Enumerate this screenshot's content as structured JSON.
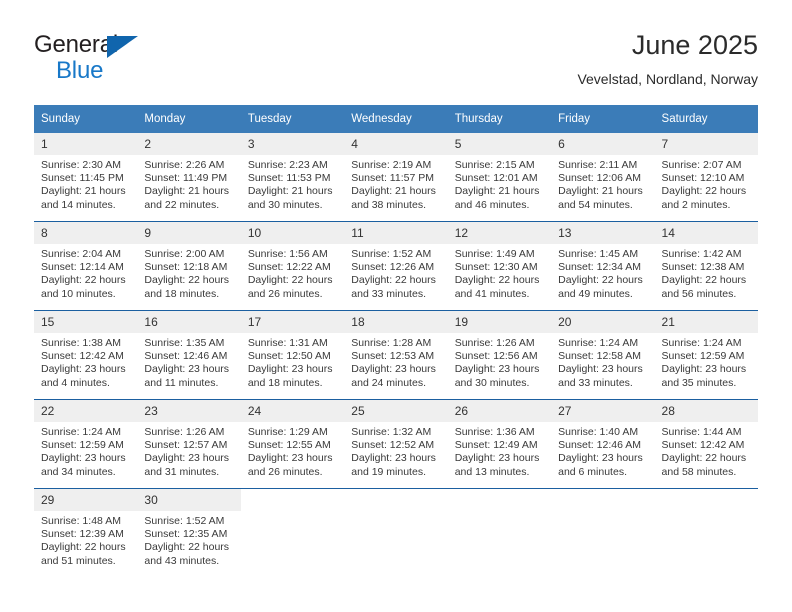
{
  "brand": {
    "line1": "General",
    "line2": "Blue",
    "triangle_icon": "triangle-icon",
    "color_dark": "#231f20",
    "color_blue": "#1878c8"
  },
  "header": {
    "title": "June 2025",
    "subtitle": "Vevelstad, Nordland, Norway"
  },
  "theme": {
    "header_bg": "#3b7cb8",
    "row_divider": "#1b5fa0",
    "daynum_bg": "#efefef"
  },
  "weekdays": [
    "Sunday",
    "Monday",
    "Tuesday",
    "Wednesday",
    "Thursday",
    "Friday",
    "Saturday"
  ],
  "weeks": [
    [
      {
        "day": "1",
        "sunrise": "Sunrise: 2:30 AM",
        "sunset": "Sunset: 11:45 PM",
        "daylight1": "Daylight: 21 hours",
        "daylight2": "and 14 minutes."
      },
      {
        "day": "2",
        "sunrise": "Sunrise: 2:26 AM",
        "sunset": "Sunset: 11:49 PM",
        "daylight1": "Daylight: 21 hours",
        "daylight2": "and 22 minutes."
      },
      {
        "day": "3",
        "sunrise": "Sunrise: 2:23 AM",
        "sunset": "Sunset: 11:53 PM",
        "daylight1": "Daylight: 21 hours",
        "daylight2": "and 30 minutes."
      },
      {
        "day": "4",
        "sunrise": "Sunrise: 2:19 AM",
        "sunset": "Sunset: 11:57 PM",
        "daylight1": "Daylight: 21 hours",
        "daylight2": "and 38 minutes."
      },
      {
        "day": "5",
        "sunrise": "Sunrise: 2:15 AM",
        "sunset": "Sunset: 12:01 AM",
        "daylight1": "Daylight: 21 hours",
        "daylight2": "and 46 minutes."
      },
      {
        "day": "6",
        "sunrise": "Sunrise: 2:11 AM",
        "sunset": "Sunset: 12:06 AM",
        "daylight1": "Daylight: 21 hours",
        "daylight2": "and 54 minutes."
      },
      {
        "day": "7",
        "sunrise": "Sunrise: 2:07 AM",
        "sunset": "Sunset: 12:10 AM",
        "daylight1": "Daylight: 22 hours",
        "daylight2": "and 2 minutes."
      }
    ],
    [
      {
        "day": "8",
        "sunrise": "Sunrise: 2:04 AM",
        "sunset": "Sunset: 12:14 AM",
        "daylight1": "Daylight: 22 hours",
        "daylight2": "and 10 minutes."
      },
      {
        "day": "9",
        "sunrise": "Sunrise: 2:00 AM",
        "sunset": "Sunset: 12:18 AM",
        "daylight1": "Daylight: 22 hours",
        "daylight2": "and 18 minutes."
      },
      {
        "day": "10",
        "sunrise": "Sunrise: 1:56 AM",
        "sunset": "Sunset: 12:22 AM",
        "daylight1": "Daylight: 22 hours",
        "daylight2": "and 26 minutes."
      },
      {
        "day": "11",
        "sunrise": "Sunrise: 1:52 AM",
        "sunset": "Sunset: 12:26 AM",
        "daylight1": "Daylight: 22 hours",
        "daylight2": "and 33 minutes."
      },
      {
        "day": "12",
        "sunrise": "Sunrise: 1:49 AM",
        "sunset": "Sunset: 12:30 AM",
        "daylight1": "Daylight: 22 hours",
        "daylight2": "and 41 minutes."
      },
      {
        "day": "13",
        "sunrise": "Sunrise: 1:45 AM",
        "sunset": "Sunset: 12:34 AM",
        "daylight1": "Daylight: 22 hours",
        "daylight2": "and 49 minutes."
      },
      {
        "day": "14",
        "sunrise": "Sunrise: 1:42 AM",
        "sunset": "Sunset: 12:38 AM",
        "daylight1": "Daylight: 22 hours",
        "daylight2": "and 56 minutes."
      }
    ],
    [
      {
        "day": "15",
        "sunrise": "Sunrise: 1:38 AM",
        "sunset": "Sunset: 12:42 AM",
        "daylight1": "Daylight: 23 hours",
        "daylight2": "and 4 minutes."
      },
      {
        "day": "16",
        "sunrise": "Sunrise: 1:35 AM",
        "sunset": "Sunset: 12:46 AM",
        "daylight1": "Daylight: 23 hours",
        "daylight2": "and 11 minutes."
      },
      {
        "day": "17",
        "sunrise": "Sunrise: 1:31 AM",
        "sunset": "Sunset: 12:50 AM",
        "daylight1": "Daylight: 23 hours",
        "daylight2": "and 18 minutes."
      },
      {
        "day": "18",
        "sunrise": "Sunrise: 1:28 AM",
        "sunset": "Sunset: 12:53 AM",
        "daylight1": "Daylight: 23 hours",
        "daylight2": "and 24 minutes."
      },
      {
        "day": "19",
        "sunrise": "Sunrise: 1:26 AM",
        "sunset": "Sunset: 12:56 AM",
        "daylight1": "Daylight: 23 hours",
        "daylight2": "and 30 minutes."
      },
      {
        "day": "20",
        "sunrise": "Sunrise: 1:24 AM",
        "sunset": "Sunset: 12:58 AM",
        "daylight1": "Daylight: 23 hours",
        "daylight2": "and 33 minutes."
      },
      {
        "day": "21",
        "sunrise": "Sunrise: 1:24 AM",
        "sunset": "Sunset: 12:59 AM",
        "daylight1": "Daylight: 23 hours",
        "daylight2": "and 35 minutes."
      }
    ],
    [
      {
        "day": "22",
        "sunrise": "Sunrise: 1:24 AM",
        "sunset": "Sunset: 12:59 AM",
        "daylight1": "Daylight: 23 hours",
        "daylight2": "and 34 minutes."
      },
      {
        "day": "23",
        "sunrise": "Sunrise: 1:26 AM",
        "sunset": "Sunset: 12:57 AM",
        "daylight1": "Daylight: 23 hours",
        "daylight2": "and 31 minutes."
      },
      {
        "day": "24",
        "sunrise": "Sunrise: 1:29 AM",
        "sunset": "Sunset: 12:55 AM",
        "daylight1": "Daylight: 23 hours",
        "daylight2": "and 26 minutes."
      },
      {
        "day": "25",
        "sunrise": "Sunrise: 1:32 AM",
        "sunset": "Sunset: 12:52 AM",
        "daylight1": "Daylight: 23 hours",
        "daylight2": "and 19 minutes."
      },
      {
        "day": "26",
        "sunrise": "Sunrise: 1:36 AM",
        "sunset": "Sunset: 12:49 AM",
        "daylight1": "Daylight: 23 hours",
        "daylight2": "and 13 minutes."
      },
      {
        "day": "27",
        "sunrise": "Sunrise: 1:40 AM",
        "sunset": "Sunset: 12:46 AM",
        "daylight1": "Daylight: 23 hours",
        "daylight2": "and 6 minutes."
      },
      {
        "day": "28",
        "sunrise": "Sunrise: 1:44 AM",
        "sunset": "Sunset: 12:42 AM",
        "daylight1": "Daylight: 22 hours",
        "daylight2": "and 58 minutes."
      }
    ],
    [
      {
        "day": "29",
        "sunrise": "Sunrise: 1:48 AM",
        "sunset": "Sunset: 12:39 AM",
        "daylight1": "Daylight: 22 hours",
        "daylight2": "and 51 minutes."
      },
      {
        "day": "30",
        "sunrise": "Sunrise: 1:52 AM",
        "sunset": "Sunset: 12:35 AM",
        "daylight1": "Daylight: 22 hours",
        "daylight2": "and 43 minutes."
      },
      {
        "day": "",
        "sunrise": "",
        "sunset": "",
        "daylight1": "",
        "daylight2": ""
      },
      {
        "day": "",
        "sunrise": "",
        "sunset": "",
        "daylight1": "",
        "daylight2": ""
      },
      {
        "day": "",
        "sunrise": "",
        "sunset": "",
        "daylight1": "",
        "daylight2": ""
      },
      {
        "day": "",
        "sunrise": "",
        "sunset": "",
        "daylight1": "",
        "daylight2": ""
      },
      {
        "day": "",
        "sunrise": "",
        "sunset": "",
        "daylight1": "",
        "daylight2": ""
      }
    ]
  ]
}
